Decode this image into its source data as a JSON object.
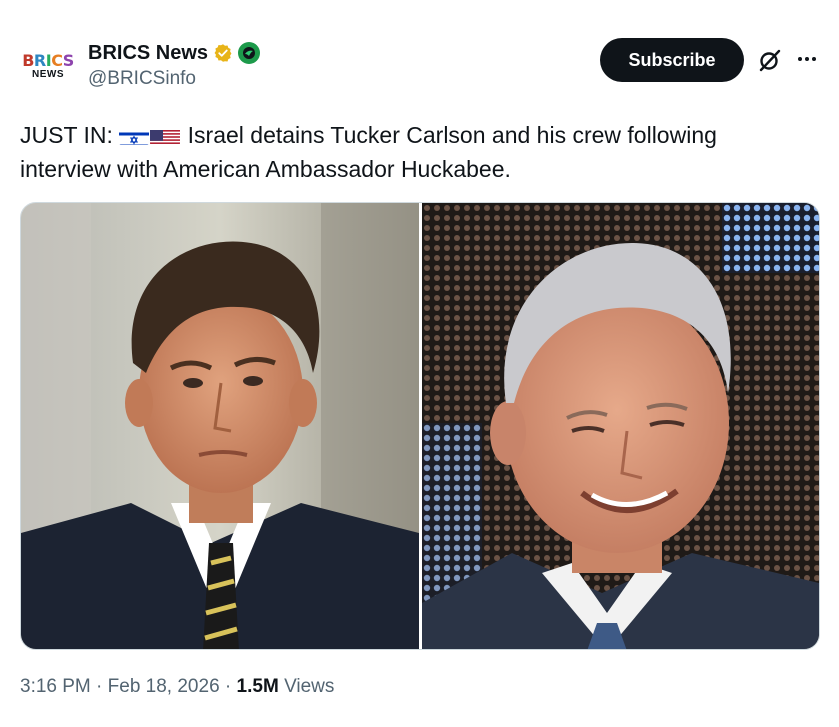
{
  "author": {
    "display_name": "BRICS News",
    "handle": "@BRICSinfo",
    "avatar_logo_top": "BRICS",
    "avatar_logo_bottom": "NEWS"
  },
  "actions": {
    "subscribe_label": "Subscribe"
  },
  "tweet": {
    "prefix": "JUST IN:",
    "text": "Israel detains Tucker Carlson and his crew following interview with American Ambassador Huckabee.",
    "flags": [
      "israel-flag-icon",
      "usa-flag-icon"
    ]
  },
  "meta": {
    "time": "3:16 PM",
    "date": "Feb 18, 2026",
    "views_count": "1.5M",
    "views_label": "Views",
    "separator": "·"
  },
  "colors": {
    "accent_dark": "#0f1419",
    "secondary_text": "#536471",
    "verified_gold": "#e8b418",
    "affiliate_green": "#1d9a4b"
  }
}
